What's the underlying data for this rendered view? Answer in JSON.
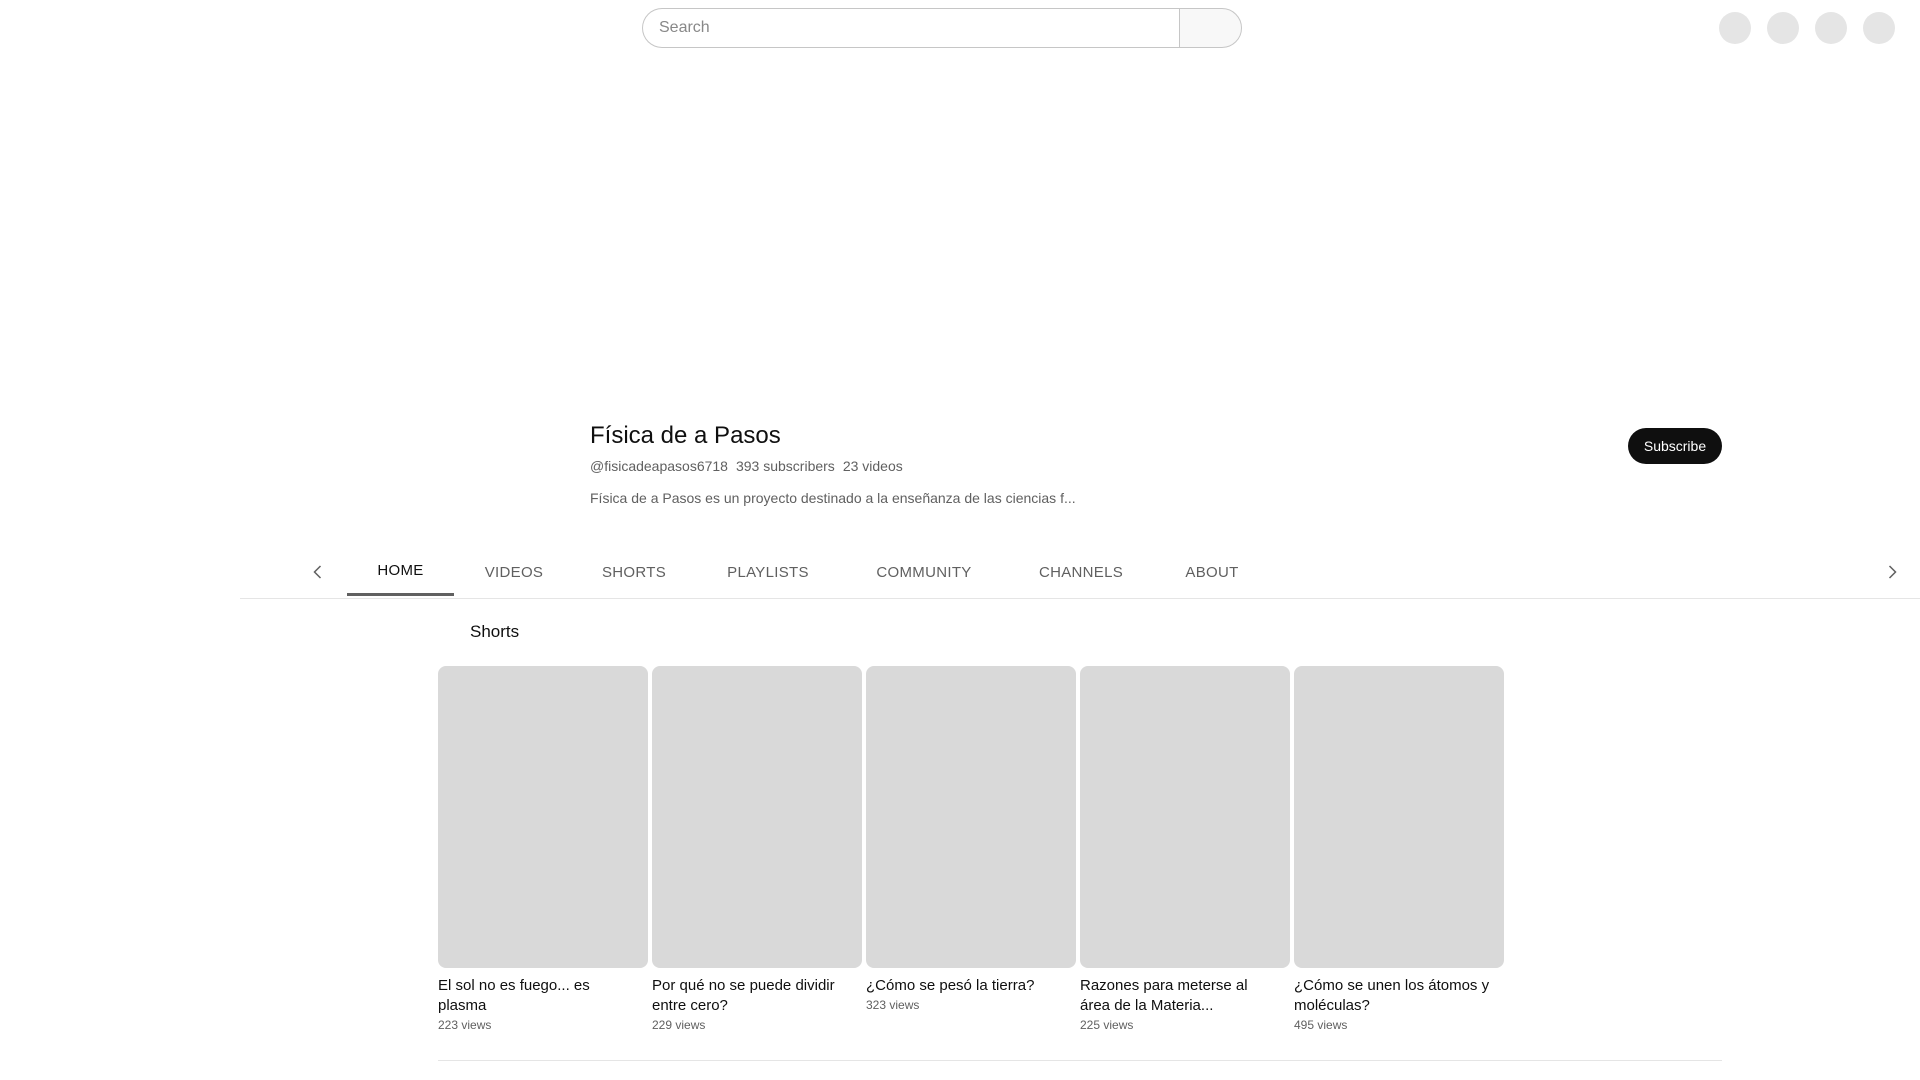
{
  "search": {
    "placeholder": "Search"
  },
  "top_icons": [
    "create-icon",
    "apps-icon",
    "notifications-icon",
    "account-icon"
  ],
  "channel": {
    "name": "Física de a Pasos",
    "handle": "@fisicadeapasos6718",
    "subscribers": "393 subscribers",
    "videos": "23 videos",
    "description": "Física de a Pasos es un proyecto destinado a la enseñanza de las ciencias f...",
    "subscribe_label": "Subscribe"
  },
  "tabs": [
    {
      "label": "HOME",
      "active": true
    },
    {
      "label": "VIDEOS"
    },
    {
      "label": "SHORTS"
    },
    {
      "label": "PLAYLISTS"
    },
    {
      "label": "COMMUNITY"
    },
    {
      "label": "CHANNELS"
    },
    {
      "label": "ABOUT"
    }
  ],
  "shorts": {
    "title": "Shorts",
    "items": [
      {
        "title": "El sol no es fuego... es plasma",
        "views": "223 views"
      },
      {
        "title": "Por qué no se puede dividir entre cero?",
        "views": "229 views"
      },
      {
        "title": "¿Cómo se pesó la tierra?",
        "views": "323 views"
      },
      {
        "title": "Razones para meterse al área de la Materia...",
        "views": "225 views"
      },
      {
        "title": "¿Cómo se unen los átomos y moléculas?",
        "views": "495 views"
      }
    ]
  }
}
